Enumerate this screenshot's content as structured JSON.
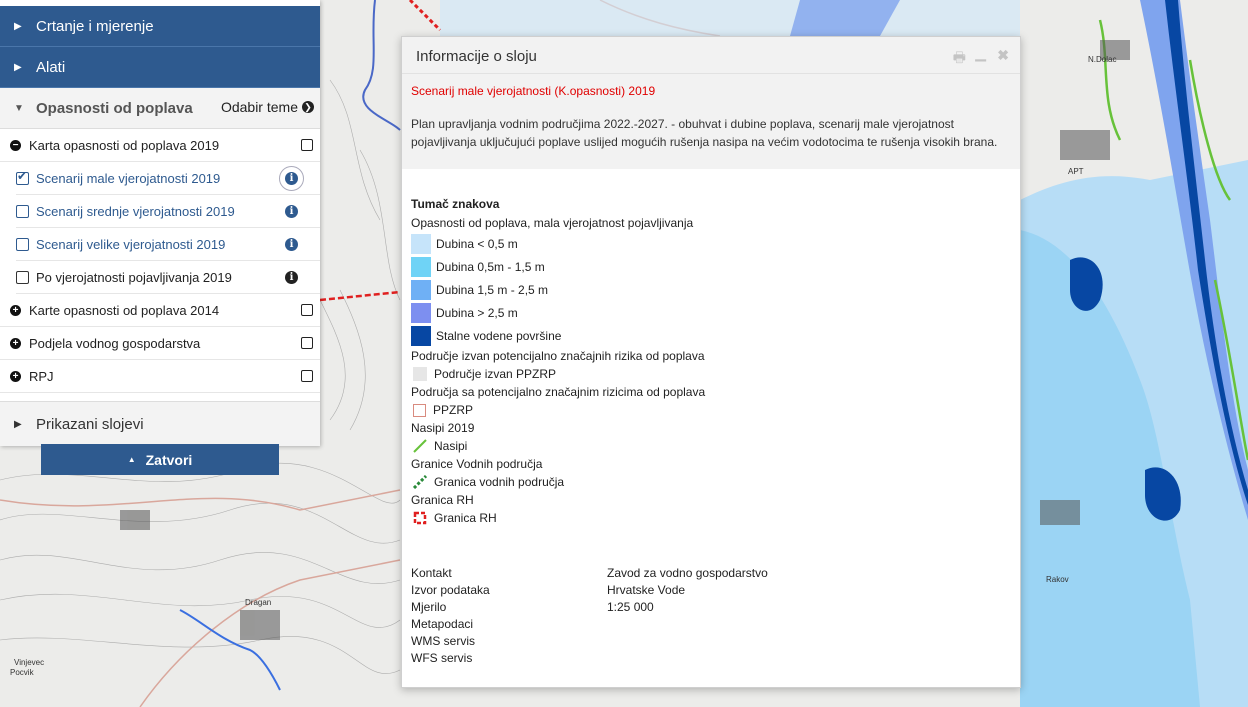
{
  "sidebar": {
    "sections": [
      {
        "label": "Crtanje i mjerenje"
      },
      {
        "label": "Alati"
      }
    ],
    "open_section": {
      "label": "Opasnosti od poplava",
      "theme_label": "Odabir teme"
    },
    "layers": [
      {
        "label": "Karta opasnosti od poplava 2019",
        "expanded": true
      },
      {
        "label": "Scenarij male vjerojatnosti 2019",
        "checked": true
      },
      {
        "label": "Scenarij srednje vjerojatnosti 2019",
        "checked": false
      },
      {
        "label": "Scenarij velike vjerojatnosti 2019",
        "checked": false
      },
      {
        "label": "Po vjerojatnosti pojavljivanja 2019",
        "checked": false
      },
      {
        "label": "Karte opasnosti od poplava 2014",
        "expanded": false
      },
      {
        "label": "Podjela vodnog gospodarstva",
        "expanded": false
      },
      {
        "label": "RPJ",
        "expanded": false
      }
    ],
    "bottom_section": {
      "label": "Prikazani slojevi"
    },
    "close_label": "Zatvori"
  },
  "dialog": {
    "title": "Informacije o sloju",
    "scenario_title": "Scenarij male vjerojatnosti (K.opasnosti) 2019",
    "description": "Plan upravljanja vodnim područjima 2022.-2027. - obuhvat i dubine poplava, scenarij male vjerojatnost pojavljivanja uključujući poplave uslijed mogućih rušenja nasipa na većim vodotocima te rušenja visokih brana.",
    "legend": {
      "heading": "Tumač znakova",
      "group1": "Opasnosti od poplava, mala vjerojatnost pojavljivanja",
      "depths": [
        {
          "label": "Dubina < 0,5 m",
          "color": "#c6e4fa"
        },
        {
          "label": "Dubina 0,5m - 1,5 m",
          "color": "#6fd3f6"
        },
        {
          "label": "Dubina 1,5 m - 2,5 m",
          "color": "#6fb0f5"
        },
        {
          "label": "Dubina > 2,5 m",
          "color": "#7d8ff0"
        },
        {
          "label": "Stalne vodene površine",
          "color": "#0747a3"
        }
      ],
      "group2": "Područje izvan potencijalno značajnih rizika od poplava",
      "item2": "Područje izvan PPZRP",
      "group3": "Područja sa potencijalno značajnim rizicima od poplava",
      "item3": "PPZRP",
      "group4": "Nasipi 2019",
      "item4": "Nasipi",
      "group5": "Granice Vodnih područja",
      "item5": "Granica vodnih područja",
      "group6": "Granica RH",
      "item6": "Granica RH"
    },
    "meta": [
      {
        "key": "Kontakt",
        "value": "Zavod za vodno gospodarstvo"
      },
      {
        "key": "Izvor podataka",
        "value": "Hrvatske Vode"
      },
      {
        "key": "Mjerilo",
        "value": "1:25 000"
      },
      {
        "key": "Metapodaci",
        "value": ""
      },
      {
        "key": "WMS servis",
        "value": ""
      },
      {
        "key": "WFS servis",
        "value": ""
      }
    ]
  },
  "map_labels": {
    "a": "N.Dolac",
    "b": "APT",
    "c": "Dragan",
    "d": "Vinjevec",
    "e": "Pocvik",
    "f": "Rakov"
  }
}
